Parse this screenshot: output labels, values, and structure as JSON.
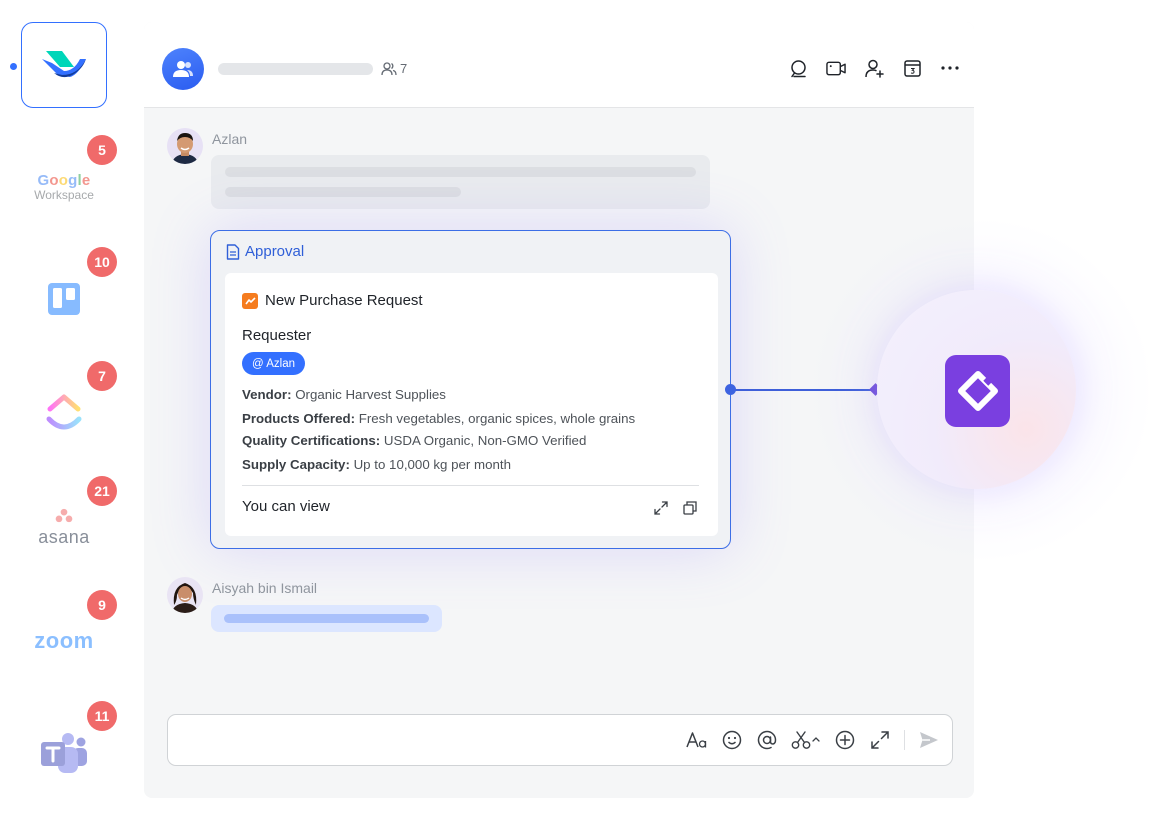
{
  "rail": {
    "apps": [
      {
        "name": "Lark",
        "active": true
      },
      {
        "name": "Google Workspace",
        "badge": "5",
        "google": "Google",
        "sub": "Workspace"
      },
      {
        "name": "Trello",
        "badge": "10"
      },
      {
        "name": "ClickUp",
        "badge": "7"
      },
      {
        "name": "Asana",
        "badge": "21",
        "label": "asana"
      },
      {
        "name": "Zoom",
        "badge": "9",
        "label": "zoom"
      },
      {
        "name": "Microsoft Teams",
        "badge": "11"
      }
    ]
  },
  "header": {
    "member_count": "7"
  },
  "messages": [
    {
      "sender": "Azlan"
    },
    {
      "sender": "Aisyah bin Ismail"
    }
  ],
  "approval": {
    "header_label": "Approval",
    "title": "New Purchase Request",
    "requester_label": "Requester",
    "mention": "@ Azlan",
    "fields": [
      {
        "label": "Vendor:",
        "value": " Organic Harvest Supplies"
      },
      {
        "label": "Products Offered:",
        "value": " Fresh vegetables, organic spices, whole grains"
      },
      {
        "label": "Quality Certifications:",
        "value": " USDA Organic, Non-GMO Verified"
      },
      {
        "label": "Supply Capacity:",
        "value": " Up to 10,000 kg per month"
      }
    ],
    "footer_text": "You can view"
  },
  "colors": {
    "accent": "#3370ff",
    "badge": "#f06a6a",
    "card_border": "#3c6ee6",
    "integration": "#7a3fe0"
  }
}
